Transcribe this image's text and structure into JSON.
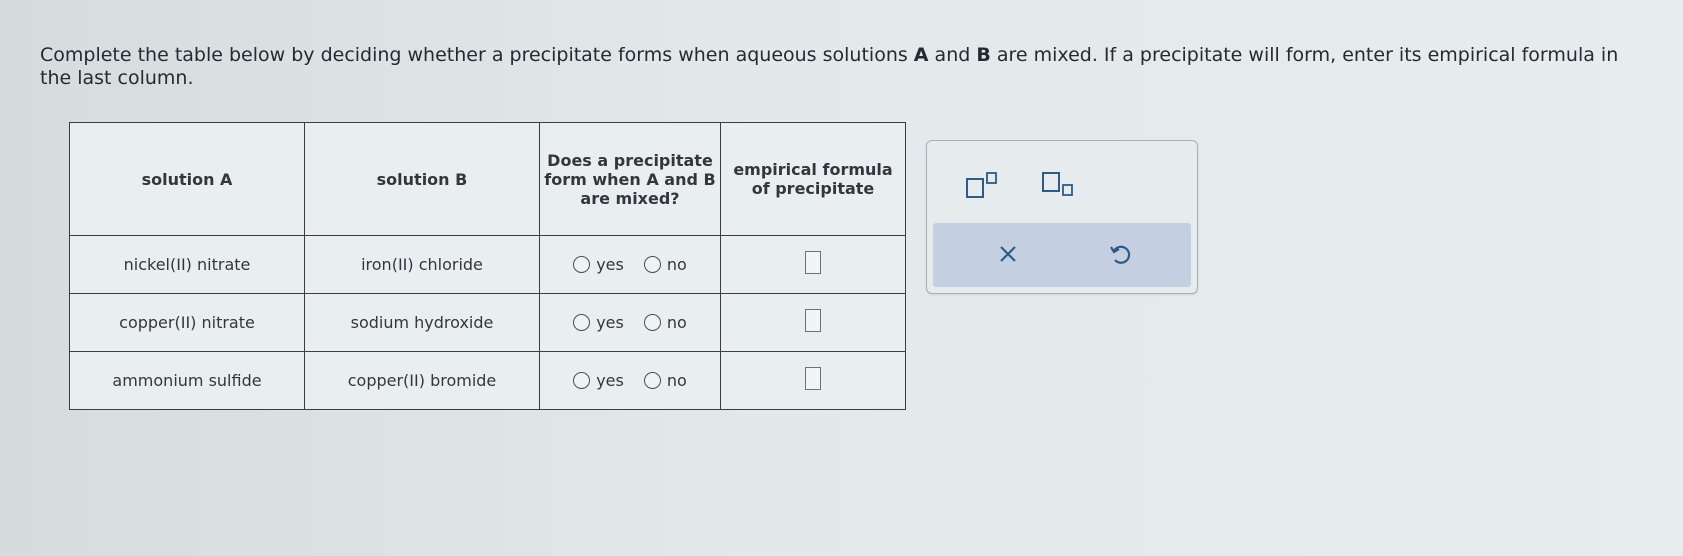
{
  "instructions": {
    "part1": "Complete the table below by deciding whether a precipitate forms when aqueous solutions ",
    "a": "A",
    "part2": " and ",
    "b": "B",
    "part3": " are mixed. If a precipitate will form, enter its empirical formula in the last column."
  },
  "table": {
    "headers": {
      "solution_a": "solution A",
      "solution_b": "solution B",
      "precipitate_q": "Does a precipitate form when A and B are mixed?",
      "formula": "empirical formula of precipitate"
    },
    "rows": [
      {
        "a": "nickel(II) nitrate",
        "b": "iron(II) chloride",
        "yes": "yes",
        "no": "no"
      },
      {
        "a": "copper(II) nitrate",
        "b": "sodium hydroxide",
        "yes": "yes",
        "no": "no"
      },
      {
        "a": "ammonium sulfide",
        "b": "copper(II) bromide",
        "yes": "yes",
        "no": "no"
      }
    ]
  },
  "toolbar": {
    "superscript_icon": "superscript-icon",
    "subscript_icon": "subscript-icon",
    "clear": "×",
    "undo_icon": "undo-icon"
  },
  "colors": {
    "action_bar": "#c4d0e2",
    "icon": "#2e5a86"
  }
}
